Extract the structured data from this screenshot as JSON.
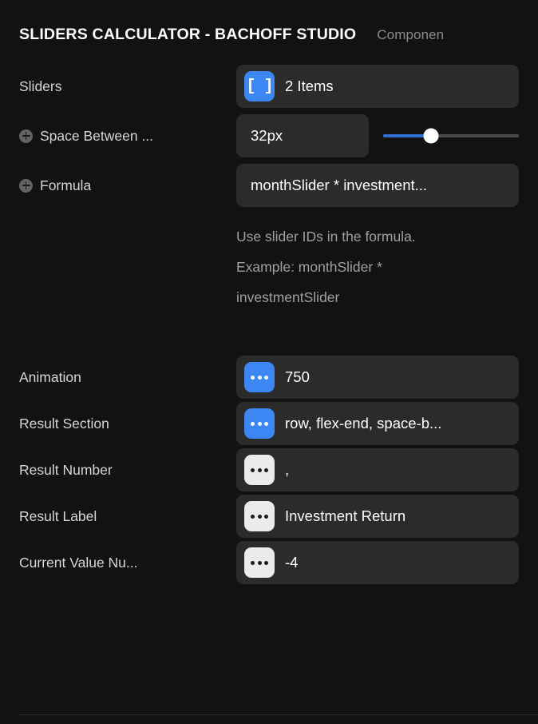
{
  "header": {
    "title": "SLIDERS CALCULATOR - BACHOFF STUDIO",
    "subtitle": "Componen"
  },
  "colors": {
    "background": "#121212",
    "field_background": "#2b2b2b",
    "accent_blue": "#3d87f5",
    "slider_fill": "#2f6fd4",
    "label_text": "#d6d6d6",
    "helper_text": "#a0a0a0",
    "chip_white": "#ebebeb"
  },
  "rows": {
    "sliders": {
      "label": "Sliders",
      "icon": "array-brackets-icon",
      "icon_glyph": "[ ]",
      "value": "2 Items"
    },
    "space_between": {
      "label": "Space Between ...",
      "add_icon": "plus-circle-icon",
      "value": "32px",
      "slider": {
        "percent": 35
      }
    },
    "formula": {
      "label": "Formula",
      "add_icon": "plus-circle-icon",
      "value": "monthSlider * investment...",
      "helper_line_1": "Use slider IDs in the formula.",
      "helper_line_2": "Example: monthSlider *",
      "helper_line_3": "investmentSlider"
    },
    "animation": {
      "label": "Animation",
      "icon": "ellipsis-icon",
      "value": "750"
    },
    "result_section": {
      "label": "Result Section",
      "icon": "ellipsis-icon",
      "value": "row, flex-end, space-b..."
    },
    "result_number": {
      "label": "Result Number",
      "icon": "ellipsis-icon",
      "value": ","
    },
    "result_label": {
      "label": "Result Label",
      "icon": "ellipsis-icon",
      "value": "Investment Return"
    },
    "current_value_number": {
      "label": "Current Value Nu...",
      "icon": "ellipsis-icon",
      "value": "-4"
    }
  }
}
